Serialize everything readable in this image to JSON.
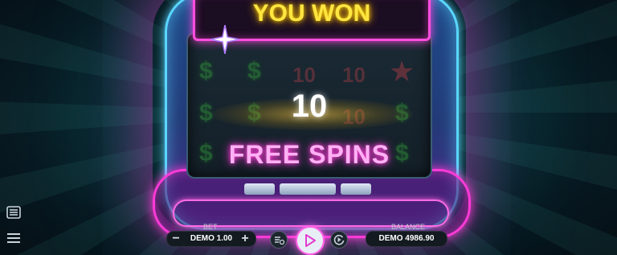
{
  "banner": {
    "title": "YOU WON"
  },
  "free_spins": {
    "count": "10",
    "label": "FREE SPINS"
  },
  "reels": {
    "dollar_symbol": "$",
    "ten_symbol": "10",
    "star_symbol": "★"
  },
  "controls": {
    "bet_label": "BET",
    "bet_value": "DEMO 1.00",
    "bet_minus": "−",
    "bet_plus": "+",
    "balance_label": "BALANCE",
    "balance_value": "DEMO 4986.90"
  },
  "colors": {
    "banner_text": "#ffe640",
    "banner_border": "#ff4ddf",
    "free_spins_text": "#ffb0f4",
    "cabinet_outline": "#5ad6ff",
    "play_ring": "#ff62e6"
  },
  "icons": [
    "paytable-icon",
    "menu-icon",
    "autoplay-settings-icon",
    "play-icon",
    "replay-icon",
    "sparkle-icon"
  ]
}
